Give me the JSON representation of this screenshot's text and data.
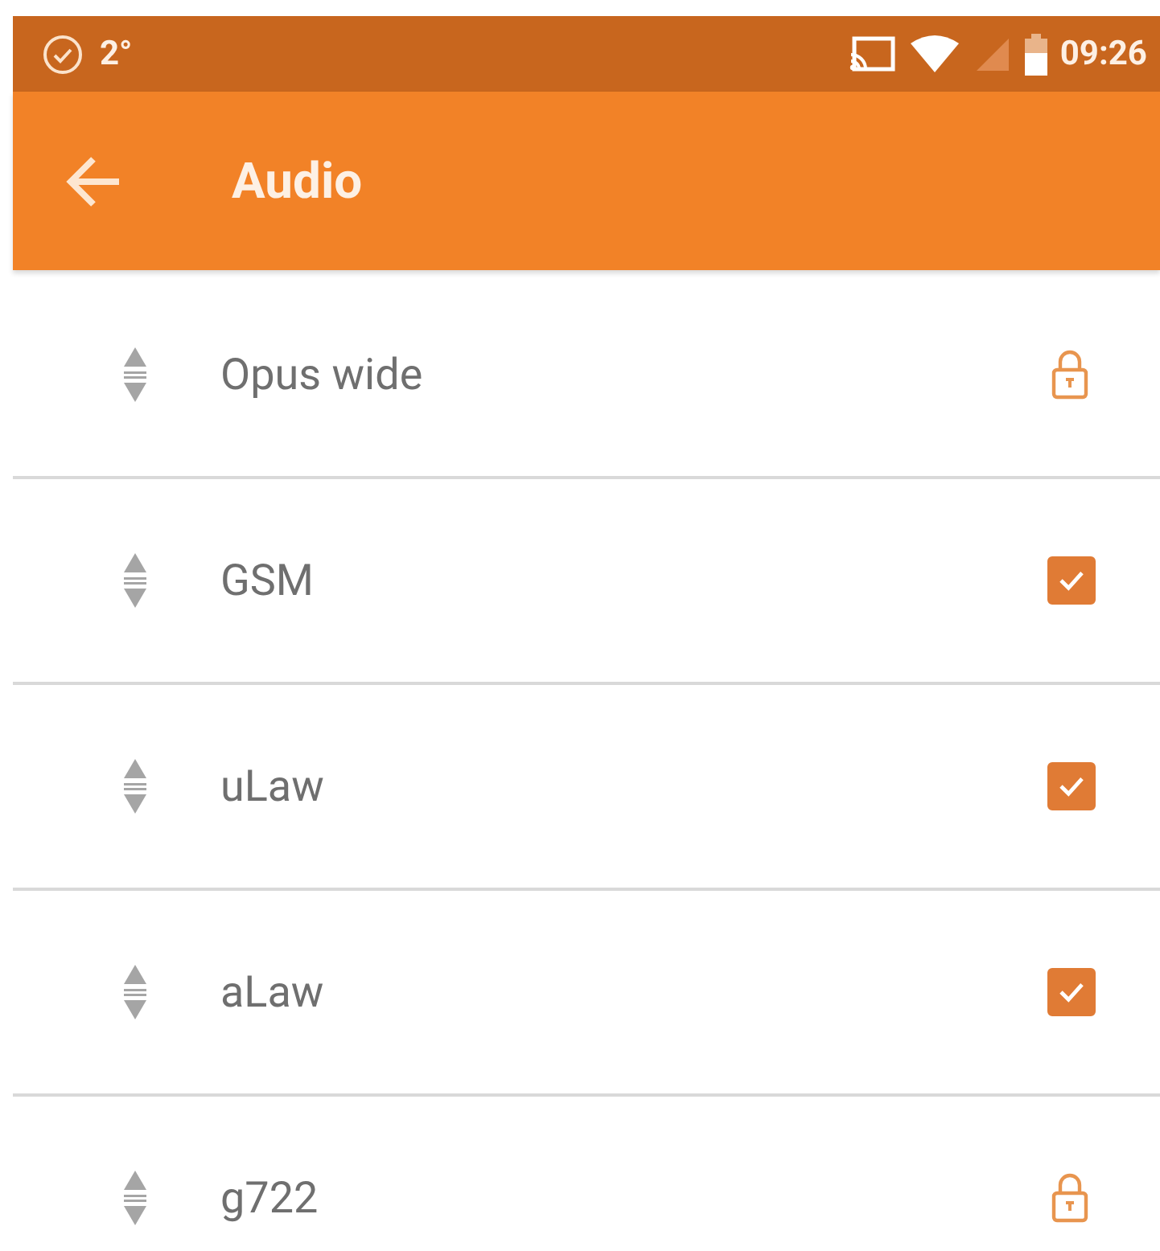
{
  "status_bar": {
    "notification": "2°",
    "time": "09:26"
  },
  "toolbar": {
    "title": "Audio"
  },
  "codecs": [
    {
      "name": "Opus wide",
      "kind": "locked"
    },
    {
      "name": "GSM",
      "kind": "checkbox",
      "checked": true
    },
    {
      "name": "uLaw",
      "kind": "checkbox",
      "checked": true
    },
    {
      "name": "aLaw",
      "kind": "checkbox",
      "checked": true
    },
    {
      "name": "g722",
      "kind": "locked"
    }
  ]
}
